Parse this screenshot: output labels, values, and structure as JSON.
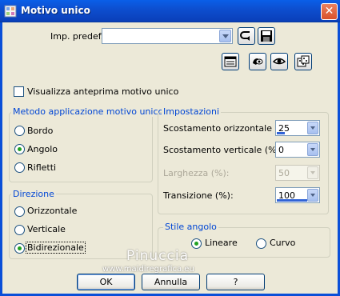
{
  "window": {
    "title": "Motivo unico",
    "close_glyph": "✕",
    "icon": "app-icon"
  },
  "preset": {
    "label": "Imp. predef.:",
    "value": ""
  },
  "toolbar_icons": [
    "load-preset-icon",
    "save-preset-icon",
    "reset-defaults-icon",
    "paint-icon",
    "preview-eye-icon",
    "randomize-icon"
  ],
  "preview_checkbox": {
    "label": "Visualizza anteprima motivo unico",
    "checked": false
  },
  "method_group": {
    "title": "Metodo applicazione motivo unico",
    "options": [
      {
        "label": "Bordo",
        "selected": false
      },
      {
        "label": "Angolo",
        "selected": true
      },
      {
        "label": "Rifletti",
        "selected": false
      }
    ]
  },
  "settings_group": {
    "title": "Impostazioni",
    "fields": [
      {
        "label": "Scostamento orizzontale (%):",
        "value": "25",
        "fill": 0.25,
        "disabled": false
      },
      {
        "label": "Scostamento verticale (%):",
        "value": "0",
        "fill": 0.0,
        "disabled": false
      },
      {
        "label": "Larghezza (%):",
        "value": "50",
        "fill": 0.5,
        "disabled": true
      },
      {
        "label": "Transizione (%):",
        "value": "100",
        "fill": 1.0,
        "disabled": false
      }
    ]
  },
  "direction_group": {
    "title": "Direzione",
    "options": [
      {
        "label": "Orizzontale",
        "selected": false
      },
      {
        "label": "Verticale",
        "selected": false
      },
      {
        "label": "Bidirezionale",
        "selected": true
      }
    ]
  },
  "corner_style_group": {
    "title": "Stile angolo",
    "options": [
      {
        "label": "Lineare",
        "selected": true
      },
      {
        "label": "Curvo",
        "selected": false
      }
    ]
  },
  "watermark": {
    "line1": "Pinuccia",
    "line2": "www.maidiregrafica.eu"
  },
  "buttons": {
    "ok": "OK",
    "cancel": "Annulla",
    "help": "?"
  },
  "colors": {
    "titlebar": "#0a5fe8",
    "group_title": "#0046d5",
    "radio_dot": "#21a121",
    "spin_fill": "#3163d6"
  }
}
